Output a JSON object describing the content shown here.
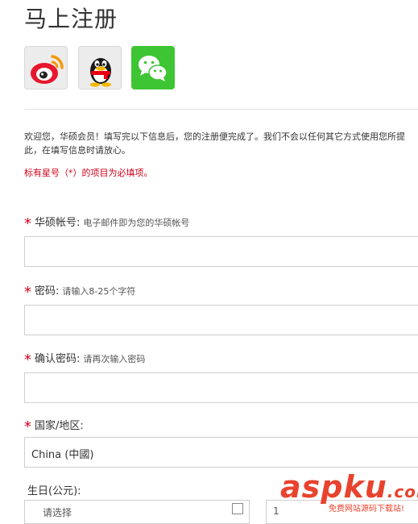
{
  "header": {
    "title": "马上注册"
  },
  "social": [
    {
      "name": "weibo",
      "icon": "weibo-icon"
    },
    {
      "name": "qq",
      "icon": "qq-penguin-icon"
    },
    {
      "name": "wechat",
      "icon": "wechat-icon"
    }
  ],
  "intro": {
    "line1": "欢迎您，华硕会员！填写完以下信息后，您的注册便完成了。我们不会以任何其它方式使用您所提",
    "line2": "此，在填写信息时请放心。",
    "required_note": "标有星号（*）的项目为必填项。"
  },
  "form": {
    "account": {
      "label": "华硕帐号:",
      "hint": "电子邮件即为您的华硕帐号",
      "value": ""
    },
    "password": {
      "label": "密码:",
      "hint": "请输入8-25个字符",
      "value": ""
    },
    "confirm": {
      "label": "确认密码:",
      "hint": "请再次输入密码",
      "value": ""
    },
    "country": {
      "label": "国家/地区:",
      "selected": "China (中國)"
    },
    "dob": {
      "label": "生日(公元):",
      "month_placeholder": "请选择",
      "day_value": "1"
    },
    "required_mark": "*"
  },
  "watermark": {
    "main": "aspku",
    "tld": ".com",
    "sub": "免费网站源码下载站!"
  },
  "colors": {
    "required": "#d0021b",
    "wechat": "#3ec534",
    "watermark": "#e8432f"
  }
}
